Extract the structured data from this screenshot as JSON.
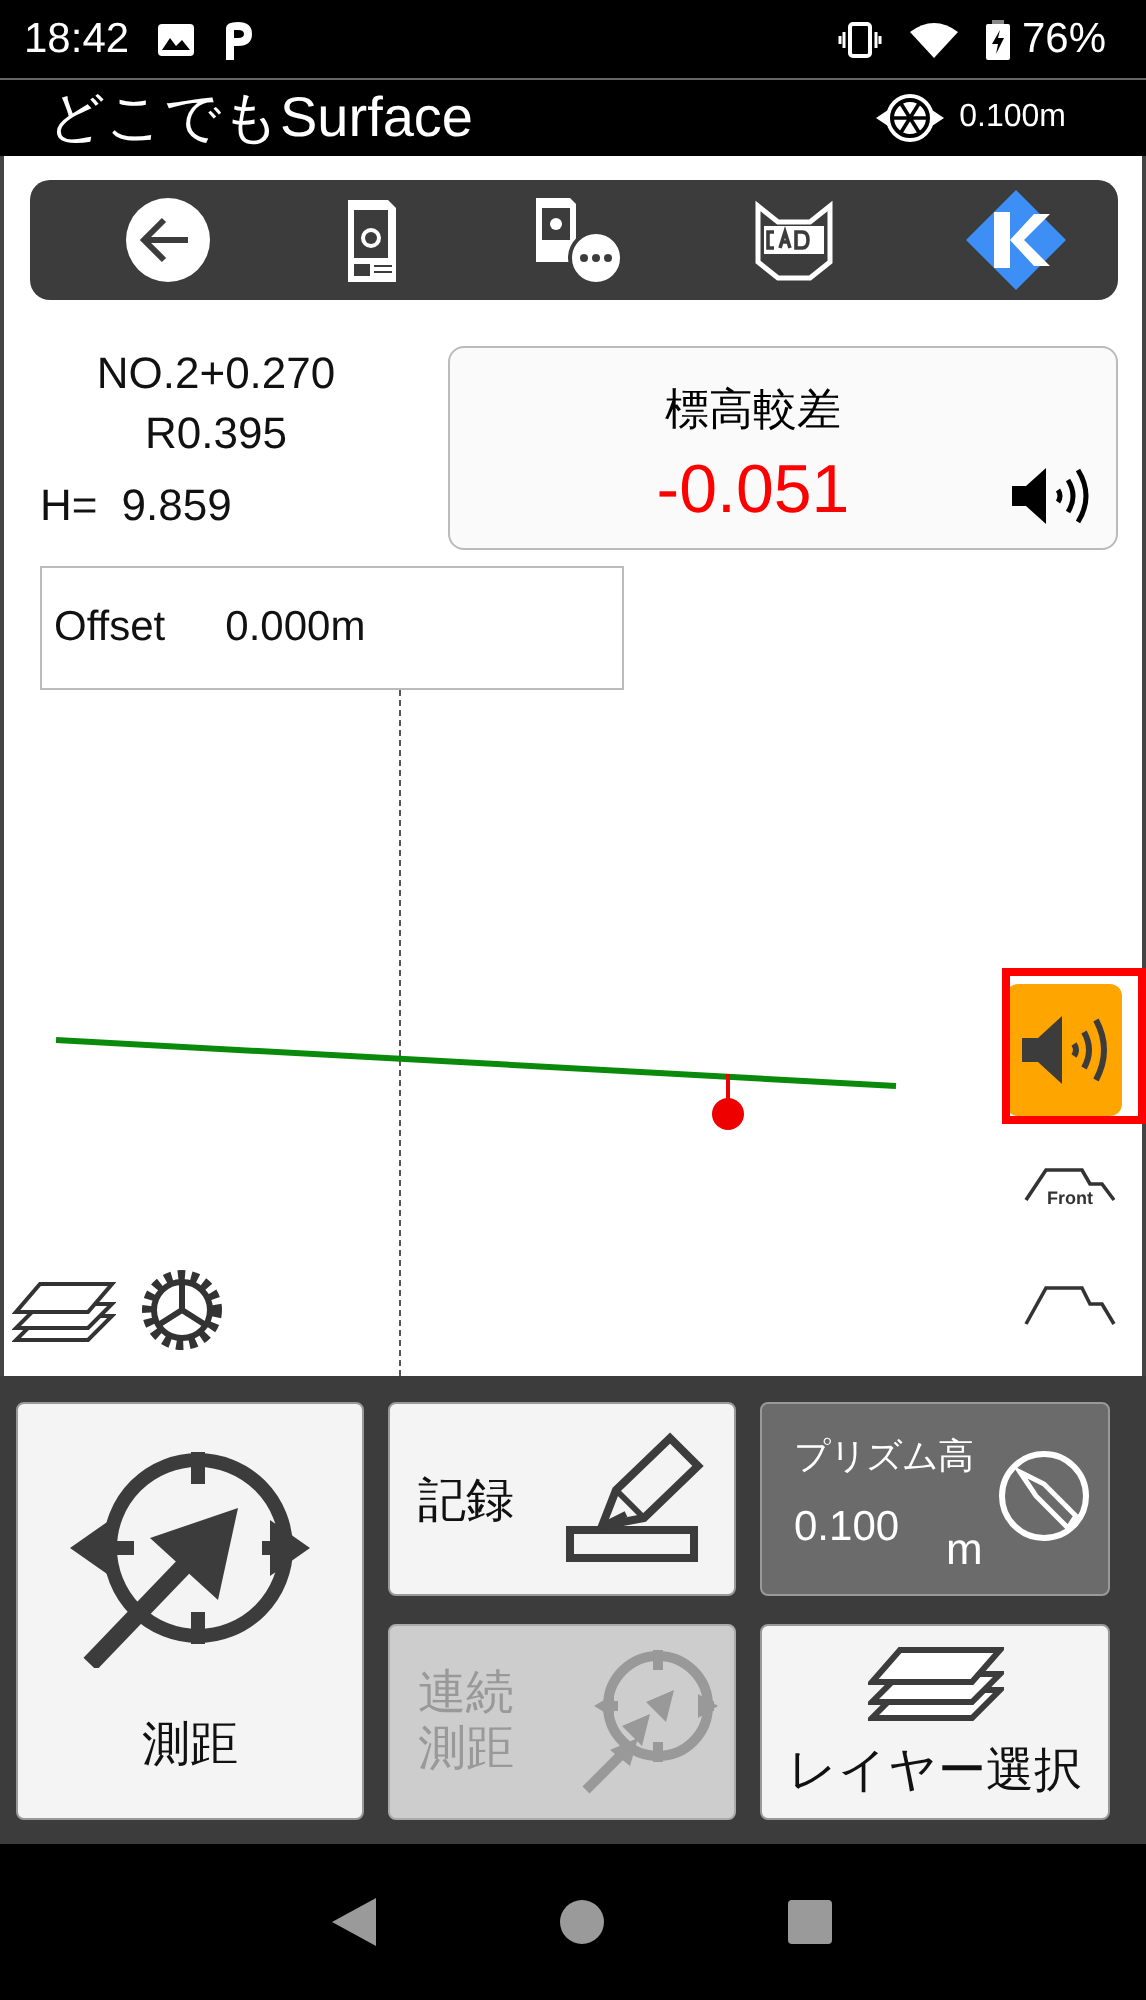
{
  "status_bar": {
    "time": "18:42",
    "battery": "76%"
  },
  "app_bar": {
    "title": "どこでもSurface",
    "prism_height": "0.100m"
  },
  "station": {
    "chainage": "NO.2+0.270",
    "radius": "R0.395",
    "height_label": "H=",
    "height_value": "9.859"
  },
  "elevation_difference": {
    "label": "標高較差",
    "value": "-0.051"
  },
  "offset": {
    "label": "Offset",
    "value": "0.000m"
  },
  "side_buttons": [
    {
      "kind": "sound",
      "highlighted": true
    },
    {
      "kind": "front",
      "label": "Front"
    },
    {
      "kind": "profile"
    }
  ],
  "actions": [
    {
      "kind": "measure",
      "label": "測距",
      "disabled": false
    },
    {
      "kind": "record",
      "label": "記録",
      "disabled": false
    },
    {
      "kind": "prism",
      "label": "プリズム高",
      "value": "0.100",
      "unit": "m",
      "disabled": false
    },
    {
      "kind": "continuous",
      "lines": [
        "連続",
        "測距"
      ],
      "disabled": true
    },
    {
      "kind": "layers",
      "label": "レイヤー選択",
      "disabled": false
    }
  ]
}
